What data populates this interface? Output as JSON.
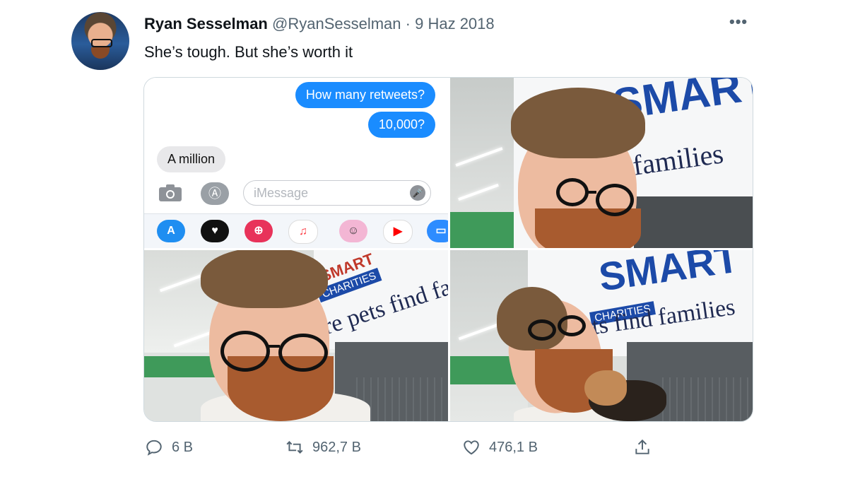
{
  "tweet": {
    "author_name": "Ryan Sesselman",
    "handle": "@RyanSesselman",
    "separator": "·",
    "date": "9 Haz 2018",
    "text": "She’s tough. But she’s worth it"
  },
  "imessage": {
    "bubbles": [
      "How many retweets?",
      "10,000?",
      "A million"
    ],
    "input_placeholder": "iMessage"
  },
  "photos": {
    "sign_brand": "SMART",
    "sign_sub": "CHARITIES",
    "sign_text_1": "re pets find fa",
    "sign_text_2": "families",
    "sign_text_3": "ts find families"
  },
  "actions": {
    "replies": "6 B",
    "retweets": "962,7 B",
    "likes": "476,1 B"
  },
  "colors": {
    "imessage_blue": "#1a8cff",
    "text_secondary": "#536471"
  }
}
